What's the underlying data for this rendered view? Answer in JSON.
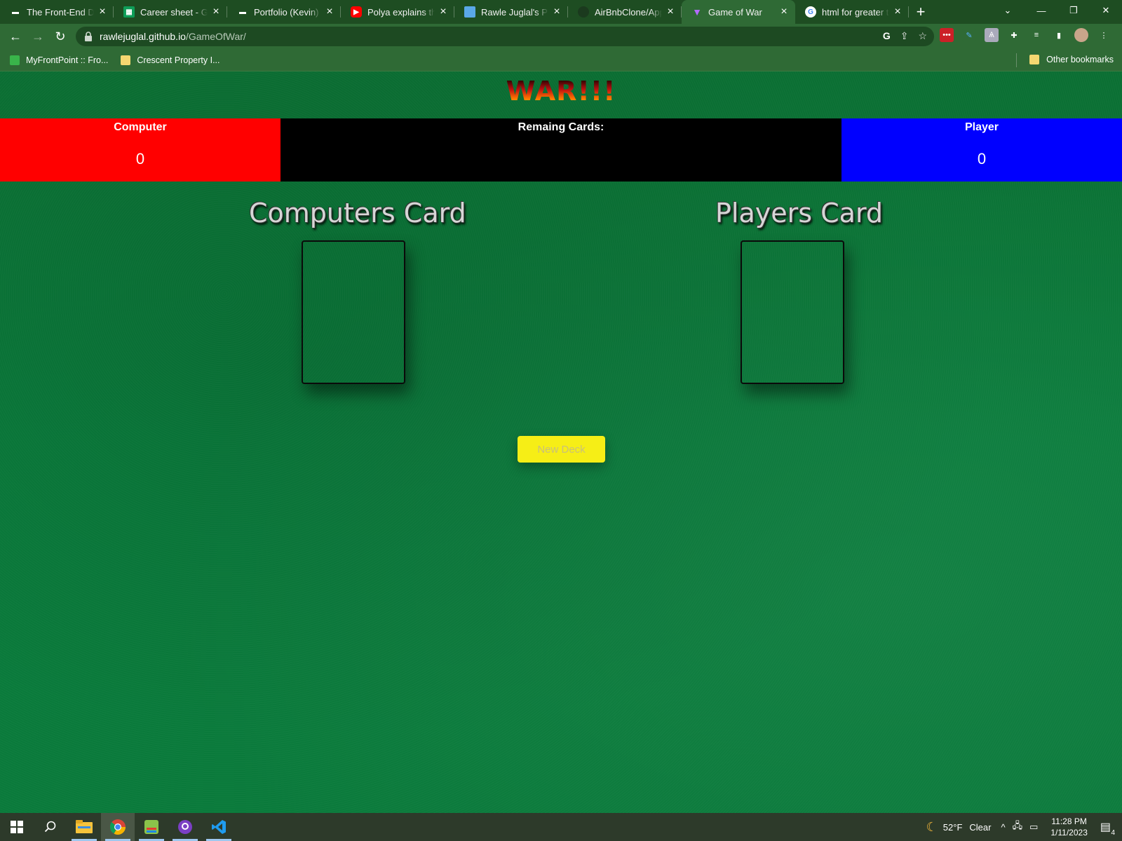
{
  "browser": {
    "tabs": [
      {
        "title": "The Front-End Dev",
        "favicon": "front-end-dev-icon",
        "active": false
      },
      {
        "title": "Career sheet - Goo",
        "favicon": "google-sheets-icon",
        "active": false
      },
      {
        "title": "Portfolio (Kevin)",
        "favicon": "portfolio-icon",
        "active": false
      },
      {
        "title": "Polya explains the",
        "favicon": "youtube-icon",
        "active": false
      },
      {
        "title": "Rawle Juglal's Portf",
        "favicon": "monitor-icon",
        "active": false
      },
      {
        "title": "AirBnbClone/App.j",
        "favicon": "github-icon",
        "active": false
      },
      {
        "title": "Game of War",
        "favicon": "vite-icon",
        "active": true
      },
      {
        "title": "html for greater th",
        "favicon": "google-icon",
        "active": false
      }
    ],
    "url_host": "rawlejuglal.github.io",
    "url_path": "/GameOfWar/",
    "bookmarks": [
      {
        "label": "MyFrontPoint :: Fro...",
        "icon": "frontpoint-icon"
      },
      {
        "label": "Crescent Property I...",
        "icon": "folder-icon"
      }
    ],
    "other_bookmarks": "Other bookmarks"
  },
  "game": {
    "title": "WAR!!!",
    "computer_label": "Computer",
    "computer_score": "0",
    "remaining_label": "Remaing Cards:",
    "remaining_value": "",
    "player_label": "Player",
    "player_score": "0",
    "computer_card_heading": "Computers Card",
    "player_card_heading": "Players Card",
    "new_deck_label": "New Deck",
    "colors": {
      "computer": "#ff0000",
      "player": "#0000ff",
      "remaining": "#000000",
      "button": "#f6ee16"
    }
  },
  "taskbar": {
    "weather_temp": "52°F",
    "weather_desc": "Clear",
    "time": "11:28 PM",
    "date": "1/11/2023",
    "notification_count": "4"
  }
}
